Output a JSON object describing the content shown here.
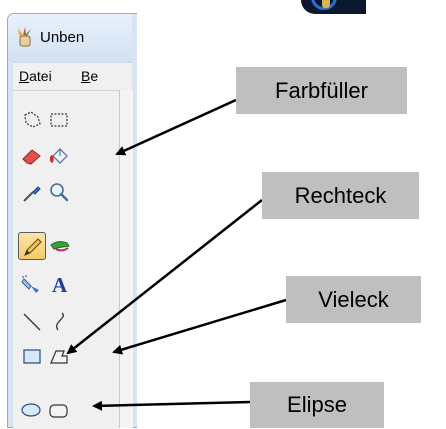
{
  "window": {
    "title": "Unben"
  },
  "menu": {
    "file_label": "Datei",
    "file_mnemonic": "D",
    "file_rest": "atei",
    "second_label_mnemonic": "B",
    "second_label_rest": "e"
  },
  "tools": [
    {
      "icon": "free-select-icon"
    },
    {
      "icon": "rect-select-icon"
    },
    {
      "icon": "eraser-icon"
    },
    {
      "icon": "fill-bucket-icon"
    },
    {
      "icon": "color-picker-icon"
    },
    {
      "icon": "magnifier-icon"
    },
    {
      "icon": "pencil-icon",
      "selected": true
    },
    {
      "icon": "brush-icon"
    },
    {
      "icon": "airbrush-icon"
    },
    {
      "icon": "text-icon",
      "glyph": "A"
    },
    {
      "icon": "line-icon"
    },
    {
      "icon": "curve-icon"
    },
    {
      "icon": "rectangle-icon"
    },
    {
      "icon": "polygon-icon"
    },
    {
      "icon": "ellipse-icon"
    },
    {
      "icon": "rounded-rect-icon"
    }
  ],
  "callouts": {
    "fill": "Farbfüller",
    "rect": "Rechteck",
    "poly": "Vieleck",
    "ellipse": "Elipse"
  },
  "colors": {
    "callout_bg": "#bfbfbf",
    "toolbox_bg": "#f0f0f0",
    "title_gradient_top": "#e9f1fb",
    "selected_tool": "#f2c96a"
  }
}
